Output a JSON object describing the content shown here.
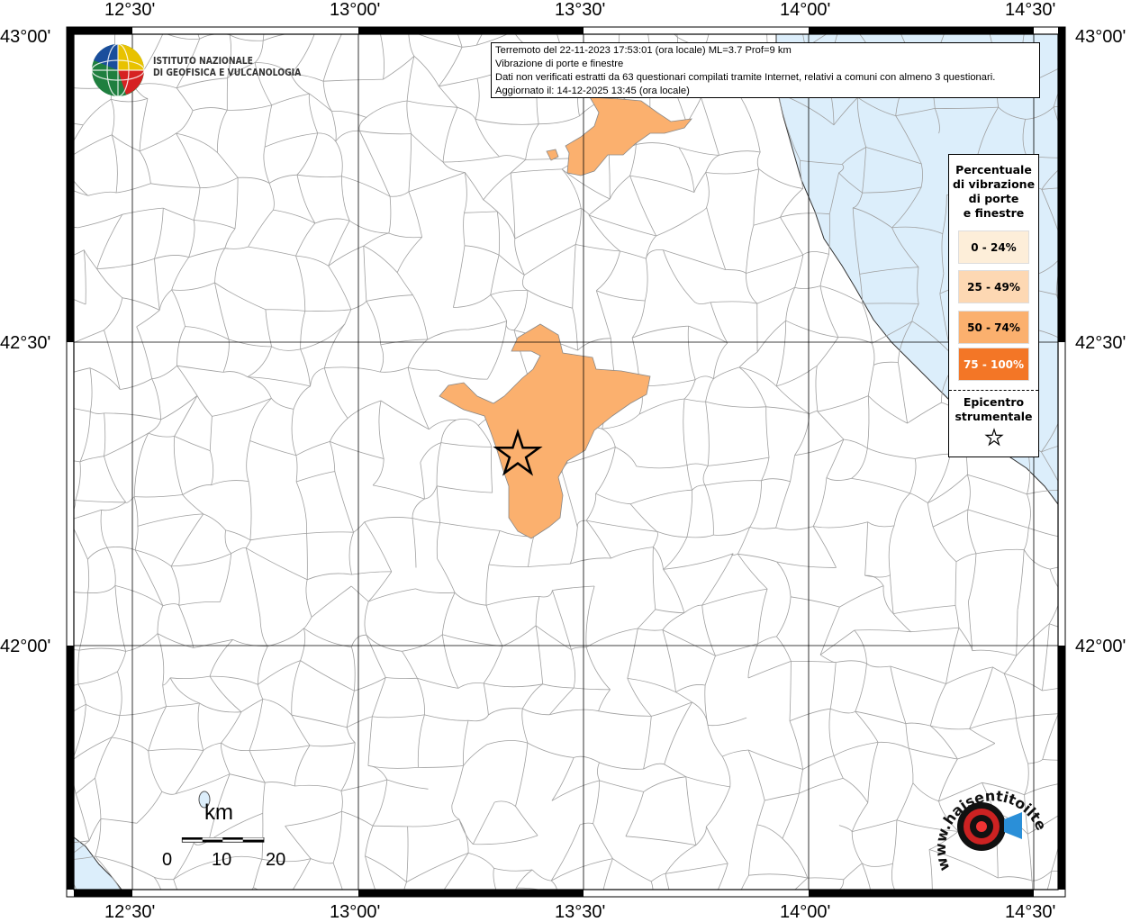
{
  "map": {
    "lon_range": [
      12.25,
      14.6
    ],
    "lat_range": [
      41.6,
      43.0
    ],
    "x_axis_labels": [
      "12°30'",
      "13°00'",
      "13°30'",
      "14°00'",
      "14°30'"
    ],
    "y_axis_labels": [
      "43°00'",
      "42°30'",
      "42°00'"
    ],
    "colors": {
      "sea": "#dceefb",
      "land": "#ffffff",
      "borders": "#9a9a9a",
      "felt_50_74": "#fbb06e",
      "felt_75_100": "#f37626",
      "felt_25_49": "#fdd8b3",
      "felt_0_24": "#fdeed9"
    },
    "epicenter": {
      "lon": 13.35,
      "lat": 42.38
    }
  },
  "info_box": {
    "line1": "Terremoto del 22-11-2023 17:53:01 (ora locale) ML=3.7 Prof=9 km",
    "line2": "Vibrazione di porte e finestre",
    "line3": "Dati non verificati estratti da 63 questionari compilati tramite Internet, relativi a comuni con almeno 3 questionari.",
    "line4": "Aggiornato il: 14-12-2025 13:45 (ora locale)"
  },
  "logo": {
    "line1": "ISTITUTO NAZIONALE",
    "line2": "DI GEOFISICA E VULCANOLOGIA",
    "icon": "globe-icon"
  },
  "legend": {
    "title_lines": [
      "Percentuale",
      "di vibrazione",
      "di porte",
      "e finestre"
    ],
    "items": [
      {
        "label": "0 - 24%",
        "color": "#fdeed9"
      },
      {
        "label": "25 - 49%",
        "color": "#fdd8b3"
      },
      {
        "label": "50 - 74%",
        "color": "#fbb06e"
      },
      {
        "label": "75 - 100%",
        "color": "#f37626"
      }
    ],
    "epicenter_lines": [
      "Epicentro",
      "strumentale"
    ],
    "epicenter_icon": "star-icon"
  },
  "scale_bar": {
    "unit": "km",
    "ticks": [
      "0",
      "10",
      "20"
    ]
  },
  "site_logo": {
    "text": "www.haisentitoilterremoto.it",
    "icon": "target-icon"
  }
}
